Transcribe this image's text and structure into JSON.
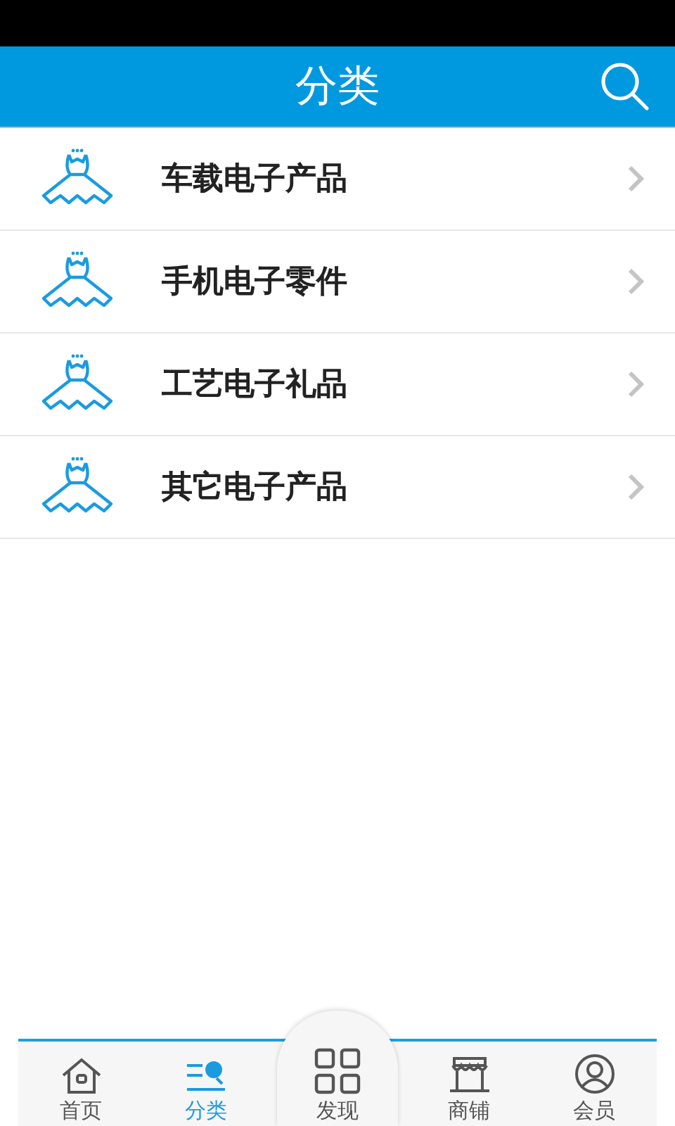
{
  "header": {
    "title": "分类"
  },
  "categories": [
    {
      "label": "车载电子产品"
    },
    {
      "label": "手机电子零件"
    },
    {
      "label": "工艺电子礼品"
    },
    {
      "label": "其它电子产品"
    }
  ],
  "tabs": [
    {
      "kind": "home",
      "label": "首页",
      "selected": false
    },
    {
      "kind": "category",
      "label": "分类",
      "selected": true
    },
    {
      "kind": "discover",
      "label": "发现",
      "selected": false
    },
    {
      "kind": "shop",
      "label": "商铺",
      "selected": false
    },
    {
      "kind": "member",
      "label": "会员",
      "selected": false
    }
  ]
}
